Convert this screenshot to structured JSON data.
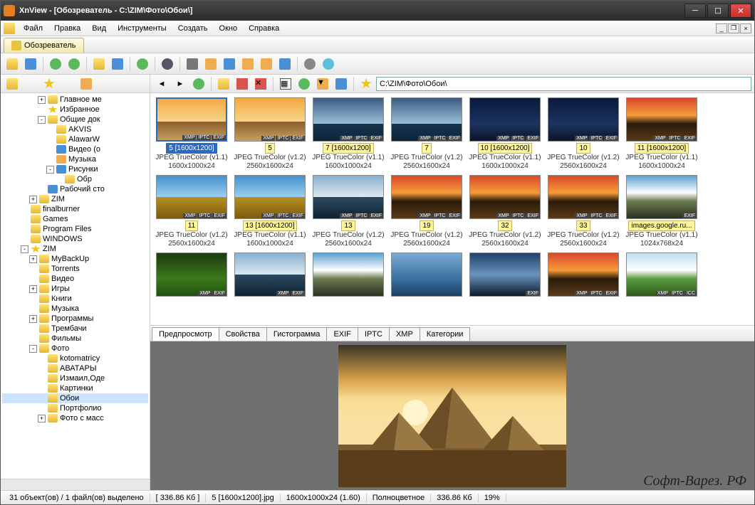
{
  "title": "XnView - [Обозреватель - C:\\ZIM\\Фото\\Обои\\]",
  "menu": [
    "Файл",
    "Правка",
    "Вид",
    "Инструменты",
    "Создать",
    "Окно",
    "Справка"
  ],
  "tab_browser": "Обозреватель",
  "address": "C:\\ZIM\\Фото\\Обои\\",
  "tree": [
    {
      "d": 4,
      "t": "+",
      "ic": "folder",
      "l": "Главное ме"
    },
    {
      "d": 4,
      "t": "",
      "ic": "star",
      "l": "Избранное"
    },
    {
      "d": 4,
      "t": "-",
      "ic": "folder",
      "l": "Общие док"
    },
    {
      "d": 5,
      "t": "",
      "ic": "folder",
      "l": "AKVIS"
    },
    {
      "d": 5,
      "t": "",
      "ic": "folder",
      "l": "AlawarW"
    },
    {
      "d": 5,
      "t": "",
      "ic": "video",
      "l": "Видео (о"
    },
    {
      "d": 5,
      "t": "",
      "ic": "music",
      "l": "Музыка"
    },
    {
      "d": 5,
      "t": "-",
      "ic": "pic",
      "l": "Рисунки"
    },
    {
      "d": 6,
      "t": "",
      "ic": "folder",
      "l": "Обр"
    },
    {
      "d": 4,
      "t": "",
      "ic": "desk",
      "l": "Рабочий сто"
    },
    {
      "d": 3,
      "t": "+",
      "ic": "folder",
      "l": "ZIM"
    },
    {
      "d": 2,
      "t": "",
      "ic": "folder",
      "l": "finalburner"
    },
    {
      "d": 2,
      "t": "",
      "ic": "folder",
      "l": "Games"
    },
    {
      "d": 2,
      "t": "",
      "ic": "folder",
      "l": "Program Files"
    },
    {
      "d": 2,
      "t": "",
      "ic": "folder",
      "l": "WINDOWS"
    },
    {
      "d": 2,
      "t": "-",
      "ic": "star",
      "l": "ZIM"
    },
    {
      "d": 3,
      "t": "+",
      "ic": "folder",
      "l": "MyBackUp"
    },
    {
      "d": 3,
      "t": "",
      "ic": "folder",
      "l": "Torrents"
    },
    {
      "d": 3,
      "t": "",
      "ic": "folder",
      "l": "Видео"
    },
    {
      "d": 3,
      "t": "+",
      "ic": "folder",
      "l": "Игры"
    },
    {
      "d": 3,
      "t": "",
      "ic": "folder",
      "l": "Книги"
    },
    {
      "d": 3,
      "t": "",
      "ic": "folder",
      "l": "Музыка"
    },
    {
      "d": 3,
      "t": "+",
      "ic": "folder",
      "l": "Программы"
    },
    {
      "d": 3,
      "t": "",
      "ic": "folder",
      "l": "Трембачи"
    },
    {
      "d": 3,
      "t": "",
      "ic": "folder",
      "l": "Фильмы"
    },
    {
      "d": 3,
      "t": "-",
      "ic": "folder",
      "l": "Фото"
    },
    {
      "d": 4,
      "t": "",
      "ic": "folder",
      "l": "kotomatricy"
    },
    {
      "d": 4,
      "t": "",
      "ic": "folder",
      "l": "АВАТАРЫ"
    },
    {
      "d": 4,
      "t": "",
      "ic": "folder",
      "l": "Измаил,Оде"
    },
    {
      "d": 4,
      "t": "",
      "ic": "folder",
      "l": "Картинки"
    },
    {
      "d": 4,
      "t": "",
      "ic": "folder",
      "l": "Обои",
      "sel": true
    },
    {
      "d": 4,
      "t": "",
      "ic": "folder",
      "l": "Портфолио"
    },
    {
      "d": 4,
      "t": "+",
      "ic": "folder",
      "l": "Фото с масс"
    }
  ],
  "thumbs": [
    {
      "n": "5 [1600x1200]",
      "c": "JPEG TrueColor (v1.1)",
      "d": "1600x1000x24",
      "a": "pyramid",
      "sel": true,
      "b": [
        "XMP",
        "IPTC",
        "EXIF"
      ]
    },
    {
      "n": "5",
      "c": "JPEG TrueColor (v1.2)",
      "d": "2560x1600x24",
      "a": "pyramid",
      "b": [
        "XMP",
        "IPTC",
        "EXIF"
      ]
    },
    {
      "n": "7 [1600x1200]",
      "c": "JPEG TrueColor (v1.1)",
      "d": "1600x1000x24",
      "a": "sea",
      "b": [
        "XMP",
        "IPTC",
        "EXIF"
      ]
    },
    {
      "n": "7",
      "c": "JPEG TrueColor (v1.2)",
      "d": "2560x1600x24",
      "a": "sea",
      "b": [
        "XMP",
        "IPTC",
        "EXIF"
      ]
    },
    {
      "n": "10 [1600x1200]",
      "c": "JPEG TrueColor (v1.1)",
      "d": "1600x1000x24",
      "a": "night",
      "b": [
        "XMP",
        "IPTC",
        "EXIF"
      ]
    },
    {
      "n": "10",
      "c": "JPEG TrueColor (v1.2)",
      "d": "2560x1600x24",
      "a": "night",
      "b": [
        "XMP",
        "IPTC",
        "EXIF"
      ]
    },
    {
      "n": "11 [1600x1200]",
      "c": "JPEG TrueColor (v1.1)",
      "d": "1600x1000x24",
      "a": "sunset",
      "b": [
        "XMP",
        "IPTC",
        "EXIF"
      ]
    },
    {
      "n": "11",
      "c": "JPEG TrueColor (v1.2)",
      "d": "2560x1600x24",
      "a": "field",
      "b": [
        "XMP",
        "IPTC",
        "EXIF"
      ]
    },
    {
      "n": "13 [1600x1200]",
      "c": "JPEG TrueColor (v1.1)",
      "d": "1600x1000x24",
      "a": "field",
      "b": [
        "XMP",
        "IPTC",
        "EXIF"
      ]
    },
    {
      "n": "13",
      "c": "JPEG TrueColor (v1.2)",
      "d": "2560x1600x24",
      "a": "shore",
      "b": [
        "XMP",
        "IPTC",
        "EXIF"
      ]
    },
    {
      "n": "19",
      "c": "JPEG TrueColor (v1.2)",
      "d": "2560x1600x24",
      "a": "sunset",
      "b": [
        "XMP",
        "IPTC",
        "EXIF"
      ]
    },
    {
      "n": "32",
      "c": "JPEG TrueColor (v1.2)",
      "d": "2560x1600x24",
      "a": "sunset",
      "b": [
        "XMP",
        "IPTC",
        "EXIF"
      ]
    },
    {
      "n": "33",
      "c": "JPEG TrueColor (v1.2)",
      "d": "2560x1600x24",
      "a": "sunset",
      "b": [
        "XMP",
        "IPTC",
        "EXIF"
      ]
    },
    {
      "n": "images.google.ru...",
      "c": "JPEG TrueColor (v1.1)",
      "d": "1024x768x24",
      "a": "mount",
      "b": [
        "EXIF"
      ]
    },
    {
      "n": "",
      "c": "",
      "d": "",
      "a": "green",
      "b": [
        "XMP",
        "EXIF"
      ]
    },
    {
      "n": "",
      "c": "",
      "d": "",
      "a": "shore",
      "b": [
        "XMP",
        "EXIF"
      ]
    },
    {
      "n": "",
      "c": "",
      "d": "",
      "a": "mount",
      "b": []
    },
    {
      "n": "",
      "c": "",
      "d": "",
      "a": "ocean",
      "b": []
    },
    {
      "n": "",
      "c": "",
      "d": "",
      "a": "clouds",
      "b": [
        "EXIF"
      ]
    },
    {
      "n": "",
      "c": "",
      "d": "",
      "a": "sunset",
      "b": [
        "XMP",
        "IPTC",
        "EXIF"
      ]
    },
    {
      "n": "",
      "c": "",
      "d": "",
      "a": "hill",
      "b": [
        "XMP",
        "IPTC",
        "ICC"
      ]
    }
  ],
  "preview_tabs": [
    "Предпросмотр",
    "Свойства",
    "Гистограмма",
    "EXIF",
    "IPTC",
    "XMP",
    "Категории"
  ],
  "status": {
    "objects": "31 объект(ов) / 1 файл(ов) выделено",
    "size": "[ 336.86 Кб ]",
    "file": "5 [1600x1200].jpg",
    "dims": "1600x1000x24 (1.60)",
    "mode": "Полноцветное",
    "fsize": "336.86 Кб",
    "zoom": "19%"
  },
  "watermark": "Софт-Варез. РФ"
}
